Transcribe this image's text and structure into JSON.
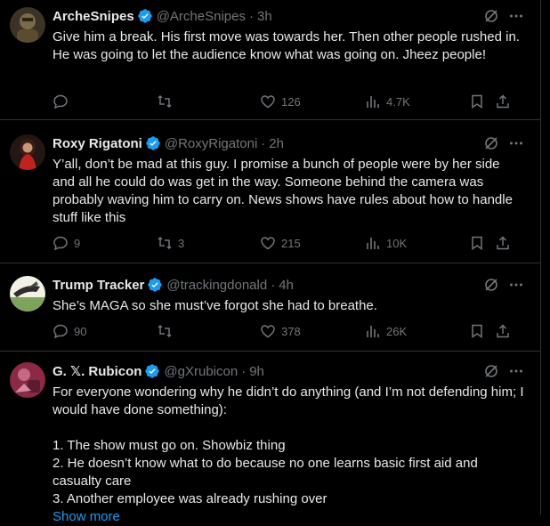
{
  "tweets": [
    {
      "name": "ArcheSnipes",
      "handle": "@ArcheSnipes",
      "time": "3h",
      "text": "Give him a break.  His first move was towards her.  Then other people rushed in.  He was going to let the audience know what was going on.  Jheez people!",
      "replies": "",
      "reposts": "",
      "likes": "126",
      "views": "4.7K",
      "avatar_color": "#6b5a3a"
    },
    {
      "name": "Roxy Rigatoni",
      "handle": "@RoxyRigatoni",
      "time": "2h",
      "text": "Y’all, don’t be mad at this guy. I promise a bunch of people were by her side and all he could do was get in the way. Someone behind the camera was probably waving him to carry on. News shows have rules about how to handle stuff like this",
      "replies": "9",
      "reposts": "3",
      "likes": "215",
      "views": "10K",
      "avatar_color": "#b3201c"
    },
    {
      "name": "Trump Tracker",
      "handle": "@trackingdonald",
      "time": "4h",
      "text": "She’s MAGA so she must’ve forgot she had to breathe.",
      "replies": "90",
      "reposts": "",
      "likes": "378",
      "views": "26K",
      "avatar_color": "#8aa86a"
    },
    {
      "name": "G. 𝕏. Rubicon",
      "handle": "@gXrubicon",
      "time": "9h",
      "text": "For everyone wondering why he didn’t do anything (and I’m not defending him; I would have done something):\n\n1. The show must go on. Showbiz thing\n2. He doesn’t know what to do because no one learns basic first aid and casualty care\n3. Another employee was already rushing over",
      "show_more": "Show more",
      "avatar_color": "#a0304a"
    }
  ],
  "colors": {
    "background": "#000000",
    "text": "#e7e9ea",
    "muted": "#71767b",
    "accent": "#1d9bf0",
    "divider": "#2f3336"
  },
  "icons": {
    "verified": "verified-badge-icon",
    "grok": "grok-icon",
    "more": "more-icon",
    "reply": "reply-icon",
    "repost": "repost-icon",
    "like": "like-icon",
    "views": "views-icon",
    "bookmark": "bookmark-icon",
    "share": "share-icon"
  }
}
